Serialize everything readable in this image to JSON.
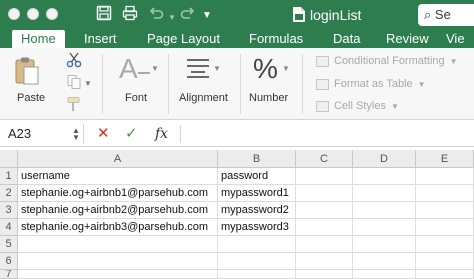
{
  "window": {
    "title": "loginList",
    "search_label": "Se"
  },
  "tabs": [
    {
      "label": "Home",
      "active": true
    },
    {
      "label": "Insert",
      "active": false
    },
    {
      "label": "Page Layout",
      "active": false
    },
    {
      "label": "Formulas",
      "active": false
    },
    {
      "label": "Data",
      "active": false
    },
    {
      "label": "Review",
      "active": false
    },
    {
      "label": "Vie",
      "active": false
    }
  ],
  "ribbon": {
    "paste_label": "Paste",
    "font_label": "Font",
    "alignment_label": "Alignment",
    "number_label": "Number",
    "styles": {
      "conditional_formatting": "Conditional Formatting",
      "format_as_table": "Format as Table",
      "cell_styles": "Cell Styles"
    }
  },
  "formula_bar": {
    "name_box": "A23",
    "fx_label": "fx",
    "content": ""
  },
  "sheet": {
    "columns": [
      "A",
      "B",
      "C",
      "D",
      "E"
    ],
    "rows": [
      {
        "row": "1",
        "cells": [
          "username",
          "password",
          "",
          "",
          ""
        ]
      },
      {
        "row": "2",
        "cells": [
          "stephanie.og+airbnb1@parsehub.com",
          "mypassword1",
          "",
          "",
          ""
        ]
      },
      {
        "row": "3",
        "cells": [
          "stephanie.og+airbnb2@parsehub.com",
          "mypassword2",
          "",
          "",
          ""
        ]
      },
      {
        "row": "4",
        "cells": [
          "stephanie.og+airbnb3@parsehub.com",
          "mypassword3",
          "",
          "",
          ""
        ]
      },
      {
        "row": "5",
        "cells": [
          "",
          "",
          "",
          "",
          ""
        ]
      },
      {
        "row": "6",
        "cells": [
          "",
          "",
          "",
          "",
          ""
        ]
      },
      {
        "row": "7",
        "cells": [
          "",
          "",
          "",
          "",
          ""
        ]
      }
    ]
  },
  "colors": {
    "accent": "#2e7d4f",
    "cancel": "#d9302c",
    "confirm": "#3a9b4a"
  }
}
